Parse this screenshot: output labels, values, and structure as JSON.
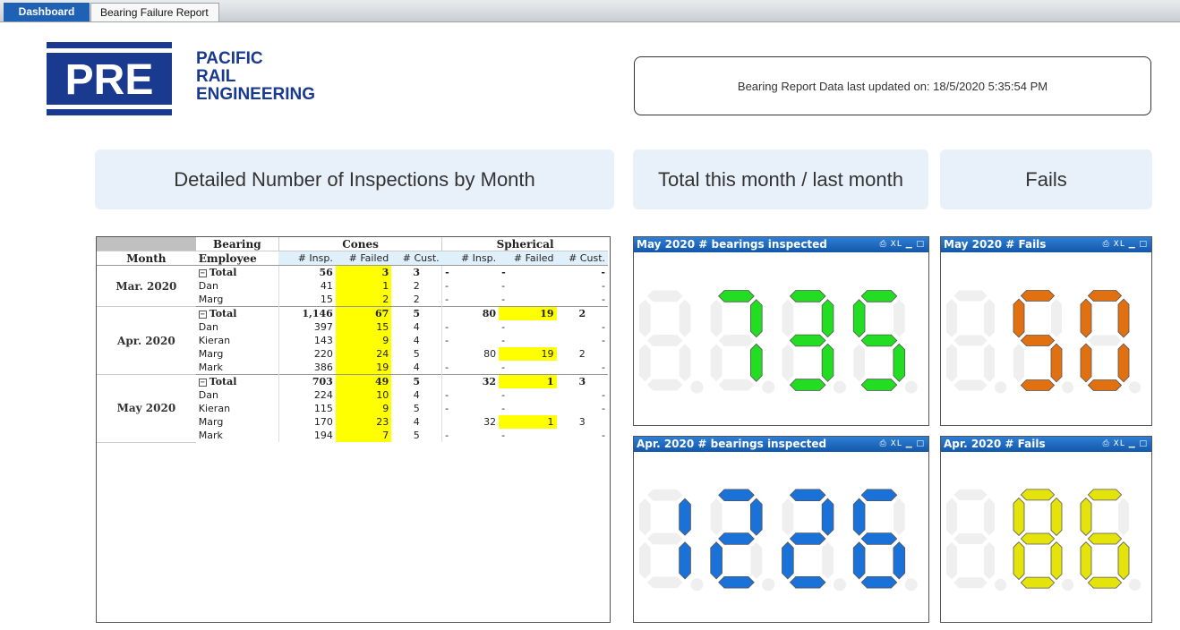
{
  "tabs": [
    {
      "label": "Dashboard",
      "active": true
    },
    {
      "label": "Bearing Failure Report",
      "active": false
    }
  ],
  "logo": {
    "mark": "PRE",
    "lines": [
      "PACIFIC",
      "RAIL",
      "ENGINEERING"
    ]
  },
  "updated_text": "Bearing Report Data last updated on: 18/5/2020 5:35:54 PM",
  "sections": {
    "detail": "Detailed Number of Inspections by Month",
    "total": "Total this month / last month",
    "fails": "Fails"
  },
  "pivot": {
    "header1": {
      "dim": "Bearing",
      "groups": [
        "Cones",
        "Spherical"
      ]
    },
    "header2": {
      "month": "Month",
      "employee": "Employee",
      "measures": [
        "# Insp.",
        "# Failed",
        "# Cust.",
        "# Insp.",
        "# Failed",
        "# Cust."
      ]
    },
    "months": [
      {
        "label": "Mar. 2020",
        "rows": [
          {
            "emp": "Total",
            "total": true,
            "cones": [
              "56",
              "3",
              "3"
            ],
            "sph": [
              "-",
              "-",
              "-"
            ]
          },
          {
            "emp": "Dan",
            "cones": [
              "41",
              "1",
              "2"
            ],
            "sph": [
              "-",
              "-",
              "-"
            ]
          },
          {
            "emp": "Marg",
            "cones": [
              "15",
              "2",
              "2"
            ],
            "sph": [
              "-",
              "-",
              "-"
            ]
          }
        ]
      },
      {
        "label": "Apr. 2020",
        "rows": [
          {
            "emp": "Total",
            "total": true,
            "cones": [
              "1,146",
              "67",
              "5"
            ],
            "sph": [
              "80",
              "19",
              "2"
            ]
          },
          {
            "emp": "Dan",
            "cones": [
              "397",
              "15",
              "4"
            ],
            "sph": [
              "-",
              "-",
              "-"
            ]
          },
          {
            "emp": "Kieran",
            "cones": [
              "143",
              "9",
              "4"
            ],
            "sph": [
              "-",
              "-",
              "-"
            ]
          },
          {
            "emp": "Marg",
            "cones": [
              "220",
              "24",
              "5"
            ],
            "sph": [
              "80",
              "19",
              "2"
            ]
          },
          {
            "emp": "Mark",
            "cones": [
              "386",
              "19",
              "4"
            ],
            "sph": [
              "-",
              "-",
              "-"
            ]
          }
        ]
      },
      {
        "label": "May 2020",
        "rows": [
          {
            "emp": "Total",
            "total": true,
            "cones": [
              "703",
              "49",
              "5"
            ],
            "sph": [
              "32",
              "1",
              "3"
            ]
          },
          {
            "emp": "Dan",
            "cones": [
              "224",
              "10",
              "4"
            ],
            "sph": [
              "-",
              "-",
              "-"
            ]
          },
          {
            "emp": "Kieran",
            "cones": [
              "115",
              "9",
              "5"
            ],
            "sph": [
              "-",
              "-",
              "-"
            ]
          },
          {
            "emp": "Marg",
            "cones": [
              "170",
              "23",
              "4"
            ],
            "sph": [
              "32",
              "1",
              "3"
            ]
          },
          {
            "emp": "Mark",
            "cones": [
              "194",
              "7",
              "5"
            ],
            "sph": [
              "-",
              "-",
              "-"
            ]
          }
        ]
      }
    ]
  },
  "panels": [
    {
      "id": "may-insp",
      "title": "May 2020 # bearings inspected",
      "value": "735",
      "digits": 4,
      "color": "#22dd22"
    },
    {
      "id": "may-fails",
      "title": "May 2020 # Fails",
      "value": "50",
      "digits": 3,
      "color": "#e07010"
    },
    {
      "id": "apr-insp",
      "title": "Apr. 2020 # bearings inspected",
      "value": "1226",
      "digits": 4,
      "color": "#1a72d8"
    },
    {
      "id": "apr-fails",
      "title": "Apr. 2020 # Fails",
      "value": "86",
      "digits": 3,
      "color": "#e4e40c"
    }
  ],
  "panel_controls": "⎙ XL ▁ □"
}
